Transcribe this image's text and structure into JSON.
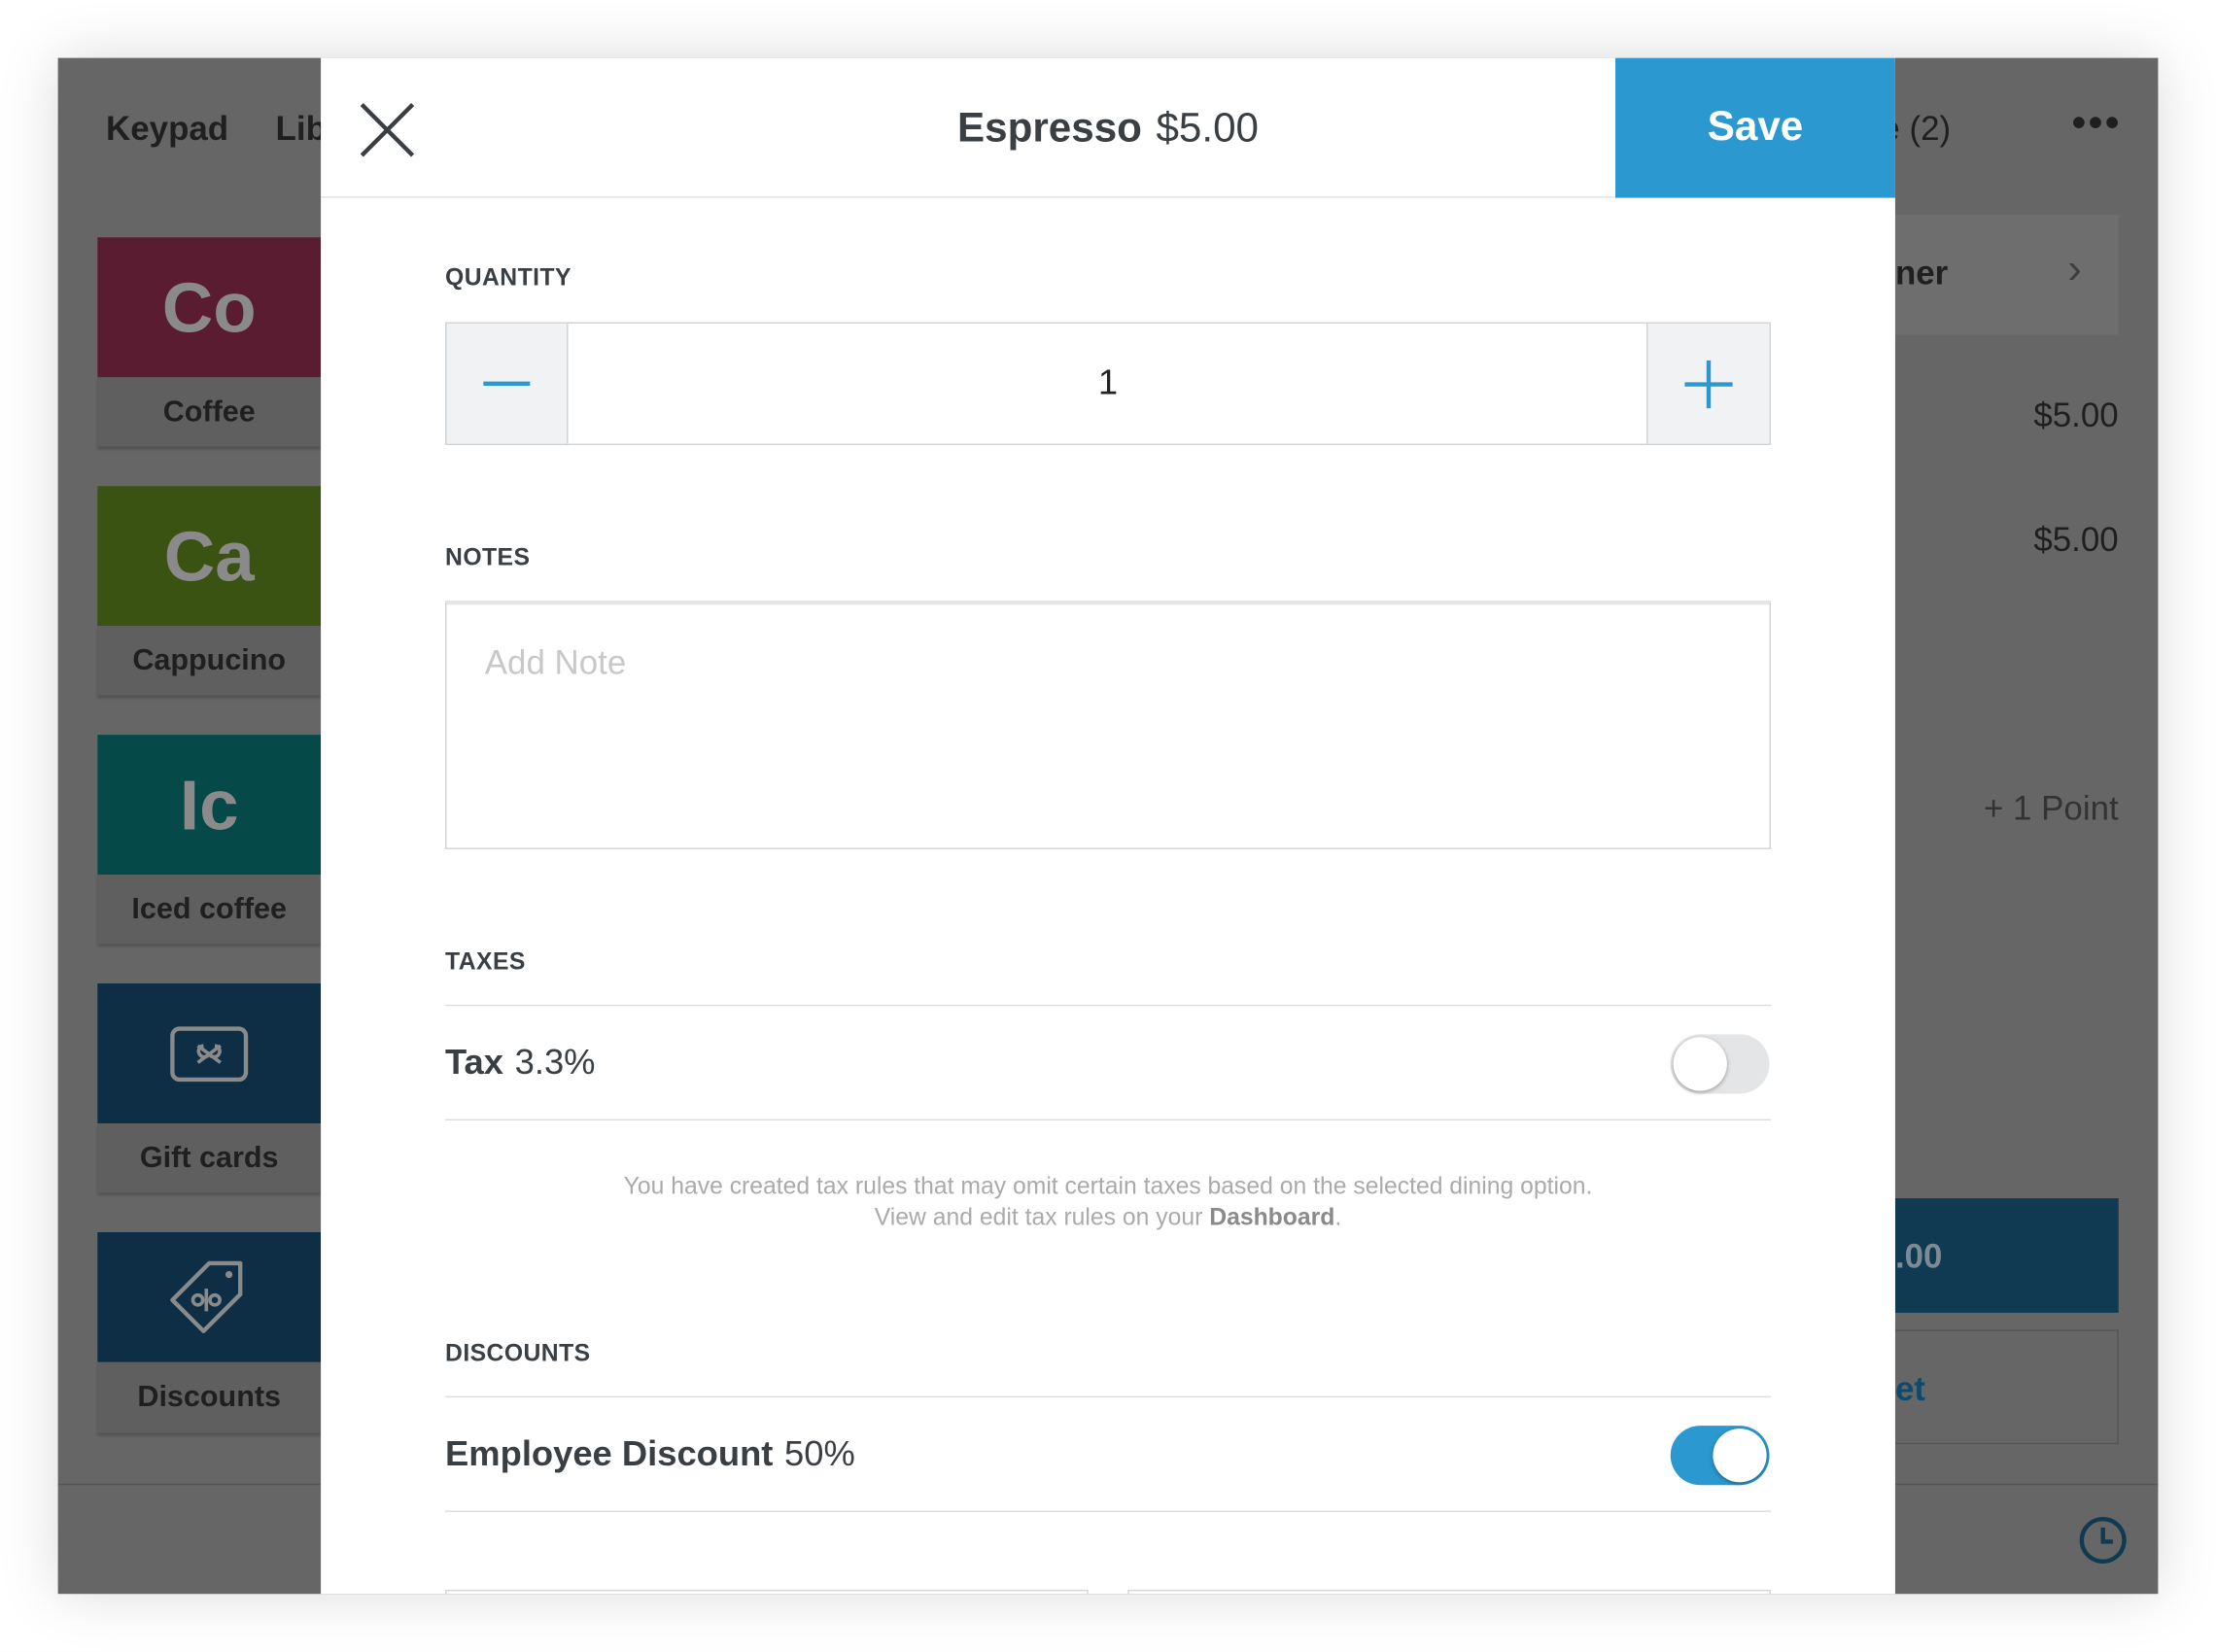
{
  "background": {
    "tabs": [
      "Keypad",
      "Lib"
    ],
    "cart_title_fragment": "e (2)",
    "more_icon": "ellipsis-icon",
    "tiles": [
      {
        "abbr": "Co",
        "label": "Coffee",
        "color": "#5a1c30"
      },
      {
        "abbr": "Ca",
        "label": "Cappucino",
        "color": "#3a5212"
      },
      {
        "abbr": "Ic",
        "label": "Iced coffee",
        "color": "#054a48"
      },
      {
        "abbr": "",
        "label": "Gift cards",
        "color": "#0d2e45",
        "icon": "gift-card-icon"
      },
      {
        "abbr": "",
        "label": "Discounts",
        "color": "#0d2e45",
        "icon": "discount-tag-icon"
      }
    ],
    "customer_fragment": "ner",
    "line_prices": [
      "$5.00",
      "$5.00"
    ],
    "points": "+ 1 Point",
    "charge_fragment": ".00",
    "ticket_fragment": "et"
  },
  "modal": {
    "item_name": "Espresso",
    "item_price": "$5.00",
    "save_label": "Save",
    "accent": "#2b98d0",
    "quantity_label": "QUANTITY",
    "quantity_value": "1",
    "notes_label": "NOTES",
    "notes_placeholder": "Add Note",
    "notes_value": "",
    "taxes_label": "TAXES",
    "tax": {
      "name": "Tax",
      "rate": "3.3%",
      "enabled": false
    },
    "tax_note_line1": "You have created tax rules that may omit certain taxes based on the selected dining option.",
    "tax_note_line2_prefix": "View and edit tax rules on your ",
    "tax_note_link": "Dashboard",
    "tax_note_suffix": ".",
    "discounts_label": "DISCOUNTS",
    "discount": {
      "name": "Employee Discount",
      "rate": "50%",
      "enabled": true
    }
  }
}
